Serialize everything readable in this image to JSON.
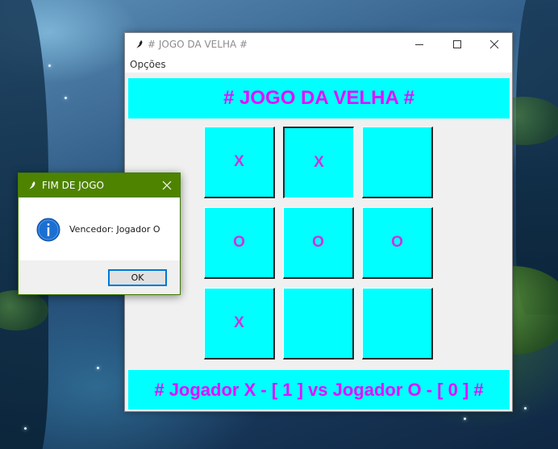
{
  "main_window": {
    "title": "# JOGO DA VELHA #",
    "icon": "feather-icon",
    "controls": {
      "minimize": "minimize-icon",
      "maximize": "maximize-icon",
      "close": "close-icon"
    },
    "menu": {
      "items": [
        "Opções"
      ]
    },
    "banner_title": "# JOGO DA VELHA #",
    "board": [
      [
        "X",
        "X",
        ""
      ],
      [
        "O",
        "O",
        "O"
      ],
      [
        "X",
        "",
        ""
      ]
    ],
    "score_text": "# Jogador X - [ 1 ] vs Jogador O - [ 0 ] #"
  },
  "dialog": {
    "title": "FIM DE JOGO",
    "icon": "feather-icon",
    "close": "close-icon",
    "message_icon": "info-icon",
    "message": "Vencedor: Jogador O",
    "ok_label": "OK"
  },
  "colors": {
    "cell_bg": "#00ffff",
    "banner_text": "#e010ff",
    "dialog_titlebar": "#4e8300",
    "ok_focus": "#0078d7"
  }
}
